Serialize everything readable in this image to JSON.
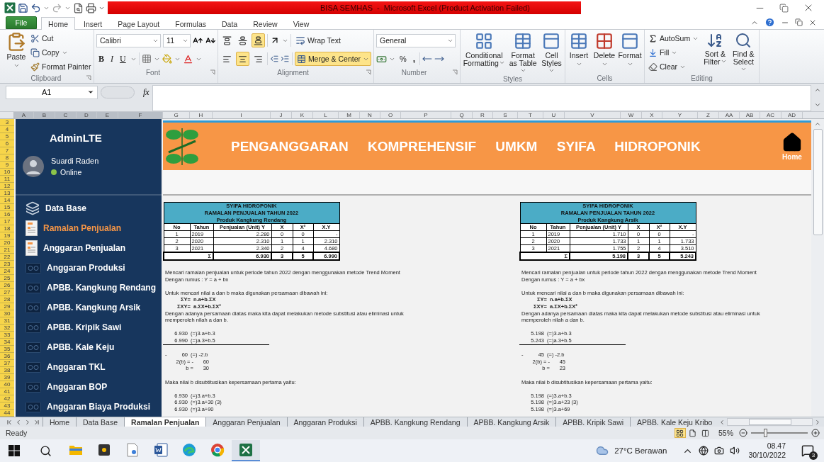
{
  "window": {
    "title": "BISA SEMHAS  -  Microsoft Excel (Product Activation Failed)"
  },
  "ribbon_tabs": [
    {
      "label": "File",
      "kind": "file",
      "selected": false
    },
    {
      "label": "Home",
      "kind": "tab",
      "selected": true
    },
    {
      "label": "Insert",
      "kind": "tab",
      "selected": false
    },
    {
      "label": "Page Layout",
      "kind": "tab",
      "selected": false
    },
    {
      "label": "Formulas",
      "kind": "tab",
      "selected": false
    },
    {
      "label": "Data",
      "kind": "tab",
      "selected": false
    },
    {
      "label": "Review",
      "kind": "tab",
      "selected": false
    },
    {
      "label": "View",
      "kind": "tab",
      "selected": false
    }
  ],
  "clipboard": {
    "label": "Clipboard",
    "paste": "Paste",
    "cut": "Cut",
    "copy": "Copy",
    "format_painter": "Format Painter"
  },
  "font": {
    "label": "Font",
    "name": "Calibri",
    "size": "11",
    "bold": "B",
    "italic": "I",
    "underline": "U"
  },
  "alignment": {
    "label": "Alignment",
    "vertical": [
      {
        "selected": false
      },
      {
        "selected": false
      },
      {
        "selected": true
      }
    ],
    "horizontal": [
      {
        "selected": false
      },
      {
        "selected": true
      },
      {
        "selected": false
      }
    ],
    "wrap_text": {
      "label": "Wrap Text",
      "selected": false
    },
    "merge_center": {
      "label": "Merge & Center",
      "selected": true
    }
  },
  "number": {
    "label": "Number",
    "format": "General",
    "percent": "%",
    "comma": ","
  },
  "styles": {
    "label": "Styles",
    "buttons": [
      {
        "label": "Conditional Formatting"
      },
      {
        "label": "Format as Table"
      },
      {
        "label": "Cell Styles"
      }
    ]
  },
  "cells": {
    "label": "Cells",
    "buttons": [
      {
        "label": "Insert"
      },
      {
        "label": "Delete"
      },
      {
        "label": "Format"
      }
    ]
  },
  "editing": {
    "label": "Editing",
    "autosum": "AutoSum",
    "fill": "Fill",
    "clear": "Clear",
    "sort_filter": "Sort & Filter",
    "find_select": "Find & Select"
  },
  "formula_bar": {
    "name_box": "A1",
    "function_label": "fx"
  },
  "columns": [
    {
      "label": "A",
      "selected": true
    },
    {
      "label": "B",
      "selected": true
    },
    {
      "label": "C",
      "selected": true
    },
    {
      "label": "D",
      "selected": true
    },
    {
      "label": "E",
      "selected": true
    },
    {
      "label": "F",
      "selected": true
    },
    {
      "label": "G",
      "selected": false
    },
    {
      "label": "H",
      "selected": false
    },
    {
      "label": "I",
      "selected": false
    },
    {
      "label": "J",
      "selected": false
    },
    {
      "label": "K",
      "selected": false
    },
    {
      "label": "L",
      "selected": false
    },
    {
      "label": "M",
      "selected": false
    },
    {
      "label": "N",
      "selected": false
    },
    {
      "label": "O",
      "selected": false
    },
    {
      "label": "P",
      "selected": false
    },
    {
      "label": "Q",
      "selected": false
    },
    {
      "label": "R",
      "selected": false
    },
    {
      "label": "S",
      "selected": false
    },
    {
      "label": "T",
      "selected": false
    },
    {
      "label": "U",
      "selected": false
    },
    {
      "label": "V",
      "selected": false
    },
    {
      "label": "W",
      "selected": false
    },
    {
      "label": "X",
      "selected": false
    },
    {
      "label": "Y",
      "selected": false
    },
    {
      "label": "Z",
      "selected": false
    },
    {
      "label": "AA",
      "selected": false
    },
    {
      "label": "AB",
      "selected": false
    },
    {
      "label": "AC",
      "selected": false
    },
    {
      "label": "AD",
      "selected": false
    }
  ],
  "rows": [
    {
      "label": "3",
      "selected": true
    },
    {
      "label": "4",
      "selected": true
    },
    {
      "label": "5",
      "selected": true
    },
    {
      "label": "6",
      "selected": true
    },
    {
      "label": "7",
      "selected": true
    },
    {
      "label": "8",
      "selected": true
    },
    {
      "label": "9",
      "selected": true
    },
    {
      "label": "10",
      "selected": true
    },
    {
      "label": "11",
      "selected": true
    },
    {
      "label": "12",
      "selected": true
    },
    {
      "label": "13",
      "selected": true
    },
    {
      "label": "14",
      "selected": true
    },
    {
      "label": "15",
      "selected": true
    },
    {
      "label": "16",
      "selected": true
    },
    {
      "label": "17",
      "selected": true
    },
    {
      "label": "18",
      "selected": true
    },
    {
      "label": "19",
      "selected": true
    },
    {
      "label": "20",
      "selected": true
    },
    {
      "label": "21",
      "selected": true
    },
    {
      "label": "22",
      "selected": true
    },
    {
      "label": "23",
      "selected": true
    },
    {
      "label": "24",
      "selected": true
    },
    {
      "label": "25",
      "selected": true
    },
    {
      "label": "26",
      "selected": true
    },
    {
      "label": "27",
      "selected": true
    },
    {
      "label": "28",
      "selected": true
    },
    {
      "label": "29",
      "selected": true
    },
    {
      "label": "30",
      "selected": true
    },
    {
      "label": "31",
      "selected": true
    },
    {
      "label": "32",
      "selected": true
    },
    {
      "label": "33",
      "selected": true
    },
    {
      "label": "34",
      "selected": true
    },
    {
      "label": "35",
      "selected": true
    },
    {
      "label": "36",
      "selected": true
    },
    {
      "label": "37",
      "selected": true
    },
    {
      "label": "38",
      "selected": true
    },
    {
      "label": "39",
      "selected": true
    },
    {
      "label": "40",
      "selected": true
    },
    {
      "label": "41",
      "selected": true
    },
    {
      "label": "42",
      "selected": true
    },
    {
      "label": "43",
      "selected": true
    },
    {
      "label": "44",
      "selected": true
    }
  ],
  "sidebar": {
    "brand": "AdminLTE",
    "user": "Suardi Raden",
    "status": "Online",
    "items": [
      {
        "label": "Data Base",
        "kind": "layers",
        "selected": false
      },
      {
        "label": "Ramalan Penjualan",
        "kind": "document",
        "selected": true
      },
      {
        "label": "Anggaran Penjualan",
        "kind": "document",
        "selected": false
      },
      {
        "label": "Anggaran Produksi",
        "kind": "tape",
        "selected": false
      },
      {
        "label": "APBB. Kangkung Rendang",
        "kind": "tape",
        "selected": false
      },
      {
        "label": "APBB. Kangkung Arsik",
        "kind": "tape",
        "selected": false
      },
      {
        "label": "APBB. Kripik Sawi",
        "kind": "tape",
        "selected": false
      },
      {
        "label": "APBB. Kale Keju",
        "kind": "tape",
        "selected": false
      },
      {
        "label": "Anggaran TKL",
        "kind": "tape",
        "selected": false
      },
      {
        "label": "Anggaran BOP",
        "kind": "tape",
        "selected": false
      },
      {
        "label": "Anggaran Biaya Produksi",
        "kind": "tape",
        "selected": false
      }
    ]
  },
  "banner": {
    "title": "PENGANGGARAN KOMPREHENSIF UMKM SYIFA HIDROPONIK",
    "home": "Home"
  },
  "panels": [
    {
      "table": {
        "title": [
          "SYIFA HIDROPONIK",
          "RAMALAN PENJUALAN TAHUN 2022",
          "Produk Kangkung Rendang"
        ],
        "columns": [
          "No",
          "Tahun",
          "Penjualan (Unit) Y",
          "X",
          "X²",
          "X.Y"
        ],
        "rows": [
          [
            "1",
            "2019",
            "2.280",
            "0",
            "0",
            "-"
          ],
          [
            "2",
            "2020",
            "2.310",
            "1",
            "1",
            "2.310"
          ],
          [
            "3",
            "2021",
            "2.340",
            "2",
            "4",
            "4.680"
          ]
        ],
        "total": {
          "label": "Σ",
          "values": [
            "6.930",
            "3",
            "5",
            "6.990"
          ]
        }
      },
      "blocks": [
        {
          "lines": [
            {
              "kind": "text",
              "text": "Mencari ramalan penjualan untuk periode tahun 2022 dengan menggunakan metode Trend Moment"
            },
            {
              "kind": "text",
              "text": "Dengan rumus : Y = a + bx"
            }
          ]
        },
        {
          "lines": [
            {
              "kind": "text",
              "text": "Untuk mencari nilai a dan b maka digunakan persamaan dibawah ini:"
            },
            {
              "kind": "formula",
              "label": "ΣY=",
              "text": "n.a+b.ΣX"
            },
            {
              "kind": "formula",
              "label": "ΣXY=",
              "text": "a.ΣX+b.ΣX²"
            },
            {
              "kind": "text",
              "text": "Dengan adanya persamaan diatas maka kita dapat melakukan metode substitusi atau eliminasi untuk"
            },
            {
              "kind": "text",
              "text": "memperoleh nilah a dan b."
            }
          ]
        },
        {
          "lines": [
            {
              "kind": "equation",
              "value": "6.930",
              "text": "(=)3.a+b.3"
            },
            {
              "kind": "equation",
              "value": "6.990",
              "text": "(=)a.3+b.5",
              "rule_after": true
            }
          ]
        },
        {
          "lines": [
            {
              "kind": "equation",
              "lead": "-",
              "value": "60",
              "text": "(=) -2.b"
            },
            {
              "kind": "solve",
              "label": "2(b) = -",
              "value": "60"
            },
            {
              "kind": "solve",
              "label": "b =",
              "value": "30"
            }
          ]
        },
        {
          "lines": [
            {
              "kind": "text",
              "text": "Maka nilai b disubtitusikan kepersamaan pertama yaitu:"
            }
          ]
        },
        {
          "lines": [
            {
              "kind": "equation",
              "value": "6.930",
              "text": "(=)3.a+b.3"
            },
            {
              "kind": "equation",
              "value": "6.930",
              "text": "(=)3.a+30 (3)"
            },
            {
              "kind": "equation",
              "value": "6.930",
              "text": "(=)3.a+90"
            }
          ]
        }
      ]
    },
    {
      "table": {
        "title": [
          "SYIFA HIDROPONIK",
          "RAMALAN PENJUALAN TAHUN 2022",
          "Produk Kangkung Arsik"
        ],
        "columns": [
          "No",
          "Tahun",
          "Penjualan (Unit) Y",
          "X",
          "X²",
          "X.Y"
        ],
        "rows": [
          [
            "1",
            "2019",
            "1.710",
            "0",
            "0",
            "-"
          ],
          [
            "2",
            "2020",
            "1.733",
            "1",
            "1",
            "1.733"
          ],
          [
            "3",
            "2021",
            "1.755",
            "2",
            "4",
            "3.510"
          ]
        ],
        "total": {
          "label": "Σ",
          "values": [
            "5.198",
            "3",
            "5",
            "5.243"
          ]
        }
      },
      "blocks": [
        {
          "lines": [
            {
              "kind": "text",
              "text": "Mencari ramalan penjualan untuk periode tahun 2022 dengan menggunakan metode Trend Moment"
            },
            {
              "kind": "text",
              "text": "Dengan rumus : Y = a + bx"
            }
          ]
        },
        {
          "lines": [
            {
              "kind": "text",
              "text": "Untuk mencari nilai a dan b maka digunakan persamaan dibawah ini:"
            },
            {
              "kind": "formula",
              "label": "ΣY=",
              "text": "n.a+b.ΣX"
            },
            {
              "kind": "formula",
              "label": "ΣXY=",
              "text": "a.ΣX+b.ΣX²"
            },
            {
              "kind": "text",
              "text": "Dengan adanya persamaan diatas maka kita dapat melakukan metode substitusi atau eliminasi untuk"
            },
            {
              "kind": "text",
              "text": "memperoleh nilah a dan b."
            }
          ]
        },
        {
          "lines": [
            {
              "kind": "equation",
              "value": "5.198",
              "text": "(=)3.a+b.3"
            },
            {
              "kind": "equation",
              "value": "5.243",
              "text": "(=)a.3+b.5",
              "rule_after": true
            }
          ]
        },
        {
          "lines": [
            {
              "kind": "equation",
              "lead": "-",
              "value": "45",
              "text": "(=) -2.b"
            },
            {
              "kind": "solve",
              "label": "2(b) = -",
              "value": "45"
            },
            {
              "kind": "solve",
              "label": "b =",
              "value": "23"
            }
          ]
        },
        {
          "lines": [
            {
              "kind": "text",
              "text": "Maka nilai b disubtitusikan kepersamaan pertama yaitu:"
            }
          ]
        },
        {
          "lines": [
            {
              "kind": "equation",
              "value": "5.198",
              "text": "(=)3.a+b.3"
            },
            {
              "kind": "equation",
              "value": "5.198",
              "text": "(=)3.a+23 (3)"
            },
            {
              "kind": "equation",
              "value": "5.198",
              "text": "(=)3.a+69"
            }
          ]
        }
      ]
    }
  ],
  "sheet_tabs": [
    {
      "label": "Home",
      "selected": false
    },
    {
      "label": "Data Base",
      "selected": false
    },
    {
      "label": "Ramalan Penjualan",
      "selected": true
    },
    {
      "label": "Anggaran Penjualan",
      "selected": false
    },
    {
      "label": "Anggaran Produksi",
      "selected": false
    },
    {
      "label": "APBB. Kangkung Rendang",
      "selected": false
    },
    {
      "label": "APBB. Kangkung Arsik",
      "selected": false
    },
    {
      "label": "APBB. Kripik Sawi",
      "selected": false
    },
    {
      "label": "APBB. Kale Keju Kribo",
      "selected": false
    }
  ],
  "status_bar": {
    "status": "Ready",
    "views": [
      {
        "selected": true
      },
      {
        "selected": false
      },
      {
        "selected": false
      }
    ],
    "zoom": {
      "label": "55%",
      "level": 0.25
    }
  },
  "taskbar": {
    "apps": [
      {
        "kind": "folder",
        "selected": false
      },
      {
        "kind": "square",
        "selected": false
      },
      {
        "kind": "page",
        "selected": false
      },
      {
        "kind": "document",
        "selected": false
      },
      {
        "kind": "swirl",
        "selected": false
      },
      {
        "kind": "ring",
        "selected": false
      },
      {
        "kind": "spreadsheet",
        "selected": true
      }
    ],
    "weather": "27°C Berawan",
    "time": "08.47",
    "date": "30/10/2022",
    "notifications": "3"
  }
}
